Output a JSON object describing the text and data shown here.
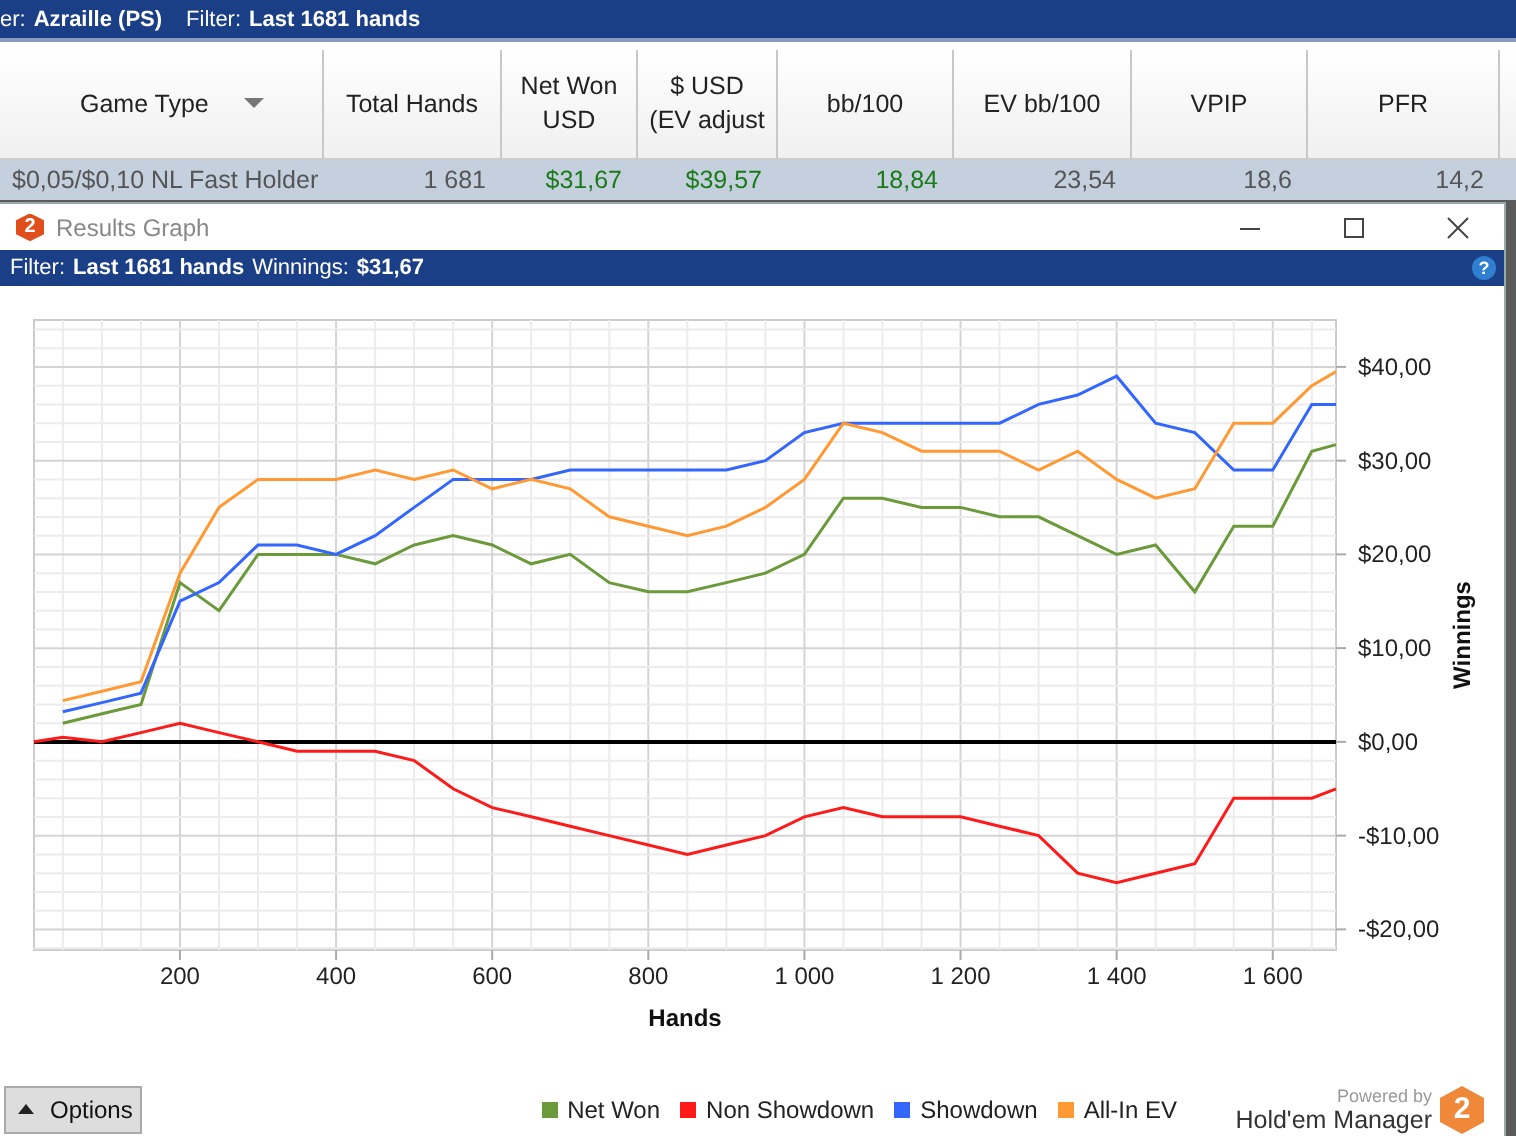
{
  "top_bar": {
    "player_label": "er:",
    "player": "Azraille (PS)",
    "filter_label": "Filter:",
    "filter": "Last 1681 hands"
  },
  "table": {
    "columns": [
      {
        "label": "Game Type",
        "sortable": true
      },
      {
        "label": "Total Hands",
        "sortable": false
      },
      {
        "label": "Net Won USD",
        "sortable": false
      },
      {
        "label": "$ USD (EV adjust",
        "sortable": false
      },
      {
        "label": "bb/100",
        "sortable": false
      },
      {
        "label": "EV bb/100",
        "sortable": false
      },
      {
        "label": "VPIP",
        "sortable": false
      },
      {
        "label": "PFR",
        "sortable": false
      }
    ],
    "rows": [
      {
        "selected": true,
        "cells": [
          {
            "text": "$0,05/$0,10 NL Fast Holder",
            "positive": false
          },
          {
            "text": "1 681",
            "positive": false
          },
          {
            "text": "$31,67",
            "positive": true
          },
          {
            "text": "$39,57",
            "positive": true
          },
          {
            "text": "18,84",
            "positive": true
          },
          {
            "text": "23,54",
            "positive": false
          },
          {
            "text": "18,6",
            "positive": false
          },
          {
            "text": "14,2",
            "positive": false
          }
        ]
      }
    ]
  },
  "dialog": {
    "logo_mark": "2",
    "title": "Results Graph",
    "filter_label": "Filter:",
    "filter": "Last 1681 hands",
    "winnings_label": "Winnings:",
    "winnings": "$31,67",
    "help": "?",
    "chart_data": {
      "type": "line",
      "xlabel": "Hands",
      "ylabel": "Winnings",
      "grid": true,
      "xlim": [
        13,
        1681
      ],
      "ylim": [
        -22.2,
        45
      ],
      "xticks": [
        {
          "value": 200,
          "label": "200"
        },
        {
          "value": 400,
          "label": "400"
        },
        {
          "value": 600,
          "label": "600"
        },
        {
          "value": 800,
          "label": "800"
        },
        {
          "value": 1000,
          "label": "1 000"
        },
        {
          "value": 1200,
          "label": "1 200"
        },
        {
          "value": 1400,
          "label": "1 400"
        },
        {
          "value": 1600,
          "label": "1 600"
        }
      ],
      "yticks": [
        {
          "value": 40,
          "label": "$40,00"
        },
        {
          "value": 30,
          "label": "$30,00"
        },
        {
          "value": 20,
          "label": "$20,00"
        },
        {
          "value": 10,
          "label": "$10,00"
        },
        {
          "value": 0,
          "label": "$0,00"
        },
        {
          "value": -10,
          "label": "-$10,00"
        },
        {
          "value": -20,
          "label": "-$20,00"
        }
      ],
      "x": [
        13,
        50,
        100,
        150,
        200,
        250,
        300,
        350,
        400,
        450,
        500,
        550,
        600,
        650,
        700,
        750,
        800,
        850,
        900,
        950,
        1000,
        1050,
        1100,
        1150,
        1200,
        1250,
        1300,
        1350,
        1400,
        1450,
        1500,
        1550,
        1600,
        1650,
        1681
      ],
      "series": [
        {
          "name": "Net Won",
          "color": "#6a9a3a",
          "values": [
            null,
            2,
            3,
            4,
            17,
            14,
            20,
            20,
            20,
            19,
            21,
            22,
            21,
            19,
            20,
            17,
            16,
            16,
            17,
            18,
            20,
            26,
            26,
            25,
            25,
            24,
            24,
            22,
            20,
            21,
            16,
            23,
            23,
            31,
            31.7
          ]
        },
        {
          "name": "Non Showdown",
          "color": "#ff1a1a",
          "values": [
            0,
            0.5,
            0,
            1,
            2,
            1,
            0,
            -1,
            -1,
            -1,
            -2,
            -5,
            -7,
            -8,
            -9,
            -10,
            -11,
            -12,
            -11,
            -10,
            -8,
            -7,
            -8,
            -8,
            -8,
            -9,
            -10,
            -14,
            -15,
            -14,
            -13,
            -6,
            -6,
            -6,
            -5
          ]
        },
        {
          "name": "Showdown",
          "color": "#3366ff",
          "values": [
            null,
            3.2,
            4.2,
            5.2,
            15,
            17,
            21,
            21,
            20,
            22,
            25,
            28,
            28,
            28,
            29,
            29,
            29,
            29,
            29,
            30,
            33,
            34,
            34,
            34,
            34,
            34,
            36,
            37,
            39,
            34,
            33,
            29,
            29,
            36,
            36
          ]
        },
        {
          "name": "All-In EV",
          "color": "#ff9933",
          "values": [
            null,
            4.4,
            5.4,
            6.4,
            18,
            25,
            28,
            28,
            28,
            29,
            28,
            29,
            27,
            28,
            27,
            24,
            23,
            22,
            23,
            25,
            28,
            34,
            33,
            31,
            31,
            31,
            29,
            31,
            28,
            26,
            27,
            34,
            34,
            38,
            39.5
          ]
        }
      ]
    }
  },
  "bottom_bar": {
    "options": "Options",
    "powered_by": "Powered by",
    "brand": "Hold'em Manager",
    "brand_mark": "2"
  }
}
